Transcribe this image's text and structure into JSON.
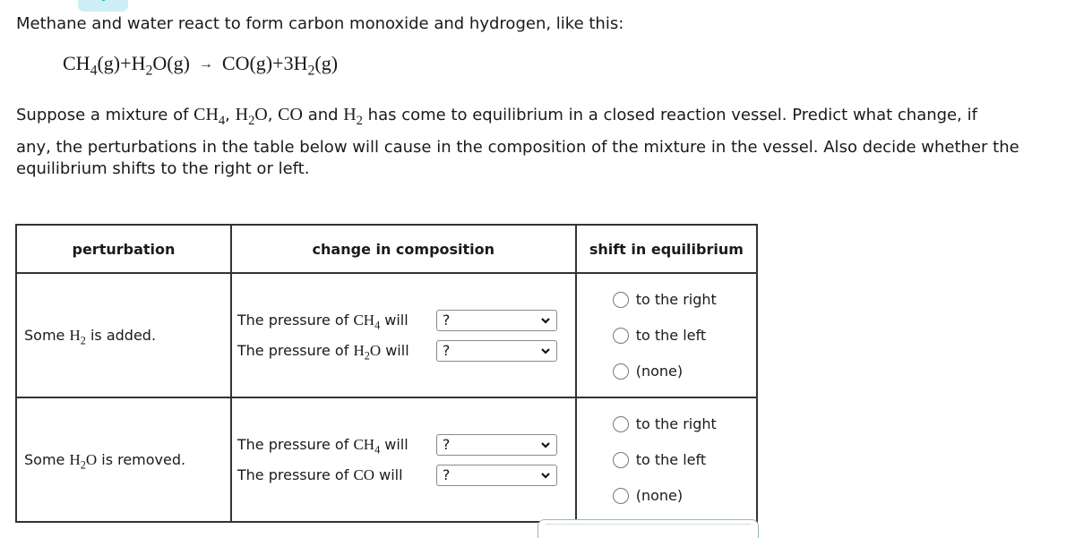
{
  "intro": "Methane and water react to form carbon monoxide and hydrogen, like this:",
  "equation": {
    "reactant1": "CH",
    "reactant1_sub": "4",
    "reactant1_state": "(g)",
    "plus1": "+",
    "reactant2_a": "H",
    "reactant2_sub": "2",
    "reactant2_b": "O",
    "reactant2_state": "(g)",
    "arrow": "→",
    "product1": "CO",
    "product1_state": "(g)",
    "plus2": "+",
    "product2_coef": "3",
    "product2": "H",
    "product2_sub": "2",
    "product2_state": "(g)"
  },
  "paragraph": {
    "p1": "Suppose a mixture of ",
    "ch4": "CH",
    "ch4_sub": "4",
    "comma1": ", ",
    "h2o_a": "H",
    "h2o_sub": "2",
    "h2o_b": "O",
    "comma2": ", ",
    "co": "CO",
    "and": " and ",
    "h2": "H",
    "h2_sub": "2",
    "p2": " has come to equilibrium in a closed reaction vessel. Predict what change, if",
    "line2": "any, the perturbations in the table below will cause in the composition of the mixture in the vessel. Also decide whether the",
    "line3": "equilibrium shifts to the right or left."
  },
  "table": {
    "headers": [
      "perturbation",
      "change in composition",
      "shift in equilibrium"
    ],
    "rows": [
      {
        "pert_pre": "Some ",
        "pert_species": "H",
        "pert_sub": "2",
        "pert_species_b": "",
        "pert_post": " is added.",
        "changes": [
          {
            "pre": "The pressure of ",
            "species": "CH",
            "sub": "4",
            "species_b": "",
            "post": " will",
            "value": "?"
          },
          {
            "pre": "The pressure of ",
            "species": "H",
            "sub": "2",
            "species_b": "O",
            "post": " will",
            "value": "?"
          }
        ],
        "options": [
          "to the right",
          "to the left",
          "(none)"
        ]
      },
      {
        "pert_pre": "Some ",
        "pert_species": "H",
        "pert_sub": "2",
        "pert_species_b": "O",
        "pert_post": " is removed.",
        "changes": [
          {
            "pre": "The pressure of ",
            "species": "CH",
            "sub": "4",
            "species_b": "",
            "post": " will",
            "value": "?"
          },
          {
            "pre": "The pressure of ",
            "species": "CO",
            "sub": "",
            "species_b": "",
            "post": " will",
            "value": "?"
          }
        ],
        "options": [
          "to the right",
          "to the left",
          "(none)"
        ]
      }
    ]
  }
}
